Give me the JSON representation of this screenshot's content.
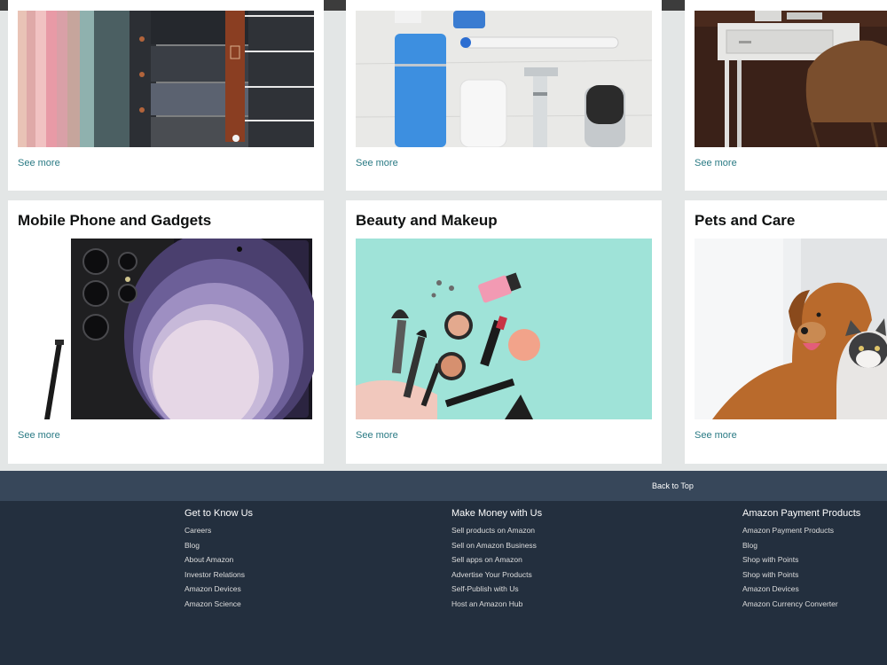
{
  "cards": [
    {
      "see_more": "See more"
    },
    {
      "see_more": "See more"
    },
    {
      "see_more": "See more"
    },
    {
      "title": "Mobile Phone and Gadgets",
      "see_more": "See more"
    },
    {
      "title": "Beauty and Makeup",
      "see_more": "See more"
    },
    {
      "title": "Pets and Care",
      "see_more": "See more"
    }
  ],
  "back_to_top": "Back to Top",
  "footer": {
    "columns": [
      {
        "heading": "Get to Know Us",
        "links": [
          "Careers",
          "Blog",
          "About Amazon",
          "Investor Relations",
          "Amazon Devices",
          "Amazon Science"
        ]
      },
      {
        "heading": "Make Money with Us",
        "links": [
          "Sell products on Amazon",
          "Sell on Amazon Business",
          "Sell apps on Amazon",
          "Advertise Your Products",
          "Self-Publish with Us",
          "Host an Amazon Hub"
        ]
      },
      {
        "heading": "Amazon Payment Products",
        "links": [
          "Amazon Payment Products",
          "Blog",
          "Shop with Points",
          "Shop with Points",
          "Amazon Devices",
          "Amazon Currency Converter"
        ]
      }
    ]
  },
  "colors": {
    "link": "#2a7a84",
    "footer_bg": "#232f3e",
    "back_to_top_bg": "#37475a",
    "page_bg": "#e3e6e6"
  }
}
